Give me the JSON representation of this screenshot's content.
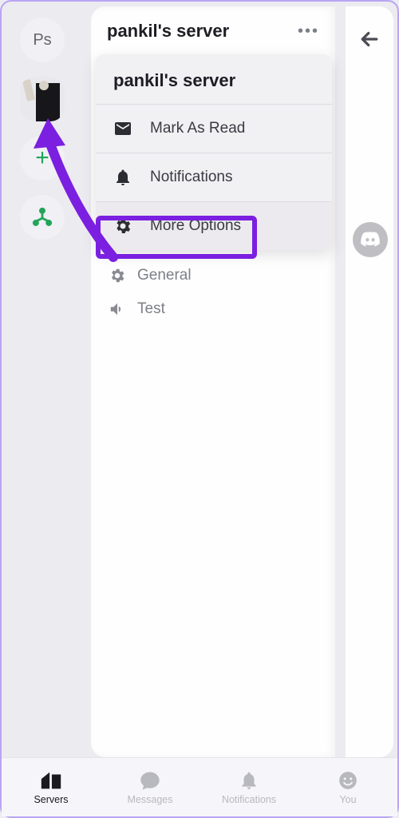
{
  "rail": {
    "initials": "Ps"
  },
  "header": {
    "title": "pankil's server"
  },
  "popup": {
    "title": "pankil's server",
    "mark_read": "Mark As Read",
    "notifications": "Notifications",
    "more_options": "More Options"
  },
  "channels": {
    "general": "General",
    "test": "Test"
  },
  "nav": {
    "servers": "Servers",
    "messages": "Messages",
    "notifications": "Notifications",
    "you": "You"
  }
}
